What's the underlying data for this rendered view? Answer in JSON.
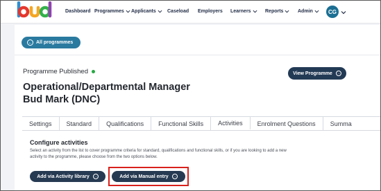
{
  "nav": {
    "logo_text": "bud",
    "items": [
      {
        "label": "Dashboard",
        "has_dropdown": false
      },
      {
        "label": "Programmes",
        "has_dropdown": true
      },
      {
        "label": "Applicants",
        "has_dropdown": true
      },
      {
        "label": "Caseload",
        "has_dropdown": false
      },
      {
        "label": "Employers",
        "has_dropdown": false
      },
      {
        "label": "Learners",
        "has_dropdown": true
      },
      {
        "label": "Reports",
        "has_dropdown": true
      },
      {
        "label": "Admin",
        "has_dropdown": true
      }
    ],
    "avatar_initials": "CG"
  },
  "header": {
    "back_button_label": "All programmes",
    "status_label": "Programme Published",
    "status_color": "#27a844",
    "view_button_label": "View Programme",
    "title_line1": "Operational/Departmental Manager",
    "title_line2": "Bud Mark (DNC)"
  },
  "tabs": [
    {
      "label": "Settings",
      "active": false
    },
    {
      "label": "Standard",
      "active": false
    },
    {
      "label": "Qualifications",
      "active": false
    },
    {
      "label": "Functional Skills",
      "active": false
    },
    {
      "label": "Activities",
      "active": true
    },
    {
      "label": "Enrolment Questions",
      "active": false
    },
    {
      "label": "Summa",
      "active": false
    }
  ],
  "activities": {
    "heading": "Configure activities",
    "description_line1": "Select an activity from the list to cover programme criteria for standard, qualifications and functional skills, or if you are looking to add a new",
    "description_line2": "activity to the programme, please choose from the two options below.",
    "library_button_label": "Add via Activity library",
    "manual_button_label": "Add via Manual entry"
  },
  "colors": {
    "brand_teal": "#1f6f94",
    "dark_button": "#263a52",
    "highlight_red": "#d9201c"
  }
}
